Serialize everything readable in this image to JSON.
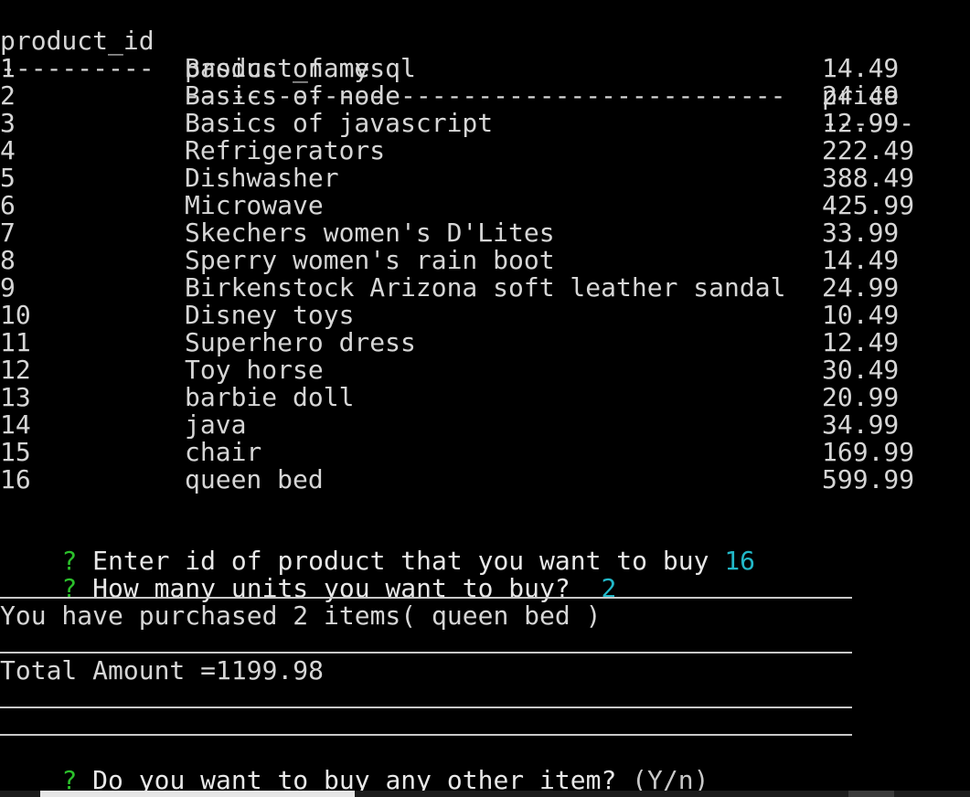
{
  "table": {
    "headers": {
      "id": "product_id",
      "name": "product_name",
      "price": "price"
    },
    "separators": {
      "id": "----------",
      "name": "---------------------------------------",
      "price": "------"
    },
    "rows": [
      {
        "id": "1",
        "name": "Basics of mysql",
        "price": "14.49"
      },
      {
        "id": "2",
        "name": "Basics of node",
        "price": "24.49"
      },
      {
        "id": "3",
        "name": "Basics of javascript",
        "price": "12.99"
      },
      {
        "id": "4",
        "name": "Refrigerators",
        "price": "222.49"
      },
      {
        "id": "5",
        "name": "Dishwasher",
        "price": "388.49"
      },
      {
        "id": "6",
        "name": "Microwave",
        "price": "425.99"
      },
      {
        "id": "7",
        "name": "Skechers women's D'Lites",
        "price": "33.99"
      },
      {
        "id": "8",
        "name": "Sperry women's rain boot",
        "price": "14.49"
      },
      {
        "id": "9",
        "name": "Birkenstock Arizona soft leather sandal",
        "price": "24.99"
      },
      {
        "id": "10",
        "name": "Disney toys",
        "price": "10.49"
      },
      {
        "id": "11",
        "name": "Superhero dress",
        "price": "12.49"
      },
      {
        "id": "12",
        "name": "Toy horse",
        "price": "30.49"
      },
      {
        "id": "13",
        "name": "barbie doll",
        "price": "20.99"
      },
      {
        "id": "14",
        "name": "java",
        "price": "34.99"
      },
      {
        "id": "15",
        "name": "chair",
        "price": "169.99"
      },
      {
        "id": "16",
        "name": "queen bed",
        "price": "599.99"
      }
    ]
  },
  "prompts": {
    "marker": "?",
    "enter_id": {
      "question": "Enter id of product that you want to buy",
      "answer": "16"
    },
    "units": {
      "question": "How many units you want to buy?",
      "answer": "2"
    },
    "buy_more": {
      "question": "Do you want to buy any other item?",
      "hint": "(Y/n)"
    }
  },
  "result": {
    "purchase_message": "You have purchased 2 items( queen bed )",
    "total_message": "Total Amount =1199.98"
  },
  "colors": {
    "background": "#000000",
    "text": "#d6d6d6",
    "prompt_marker": "#2bc02b",
    "answer": "#22b8c8"
  }
}
